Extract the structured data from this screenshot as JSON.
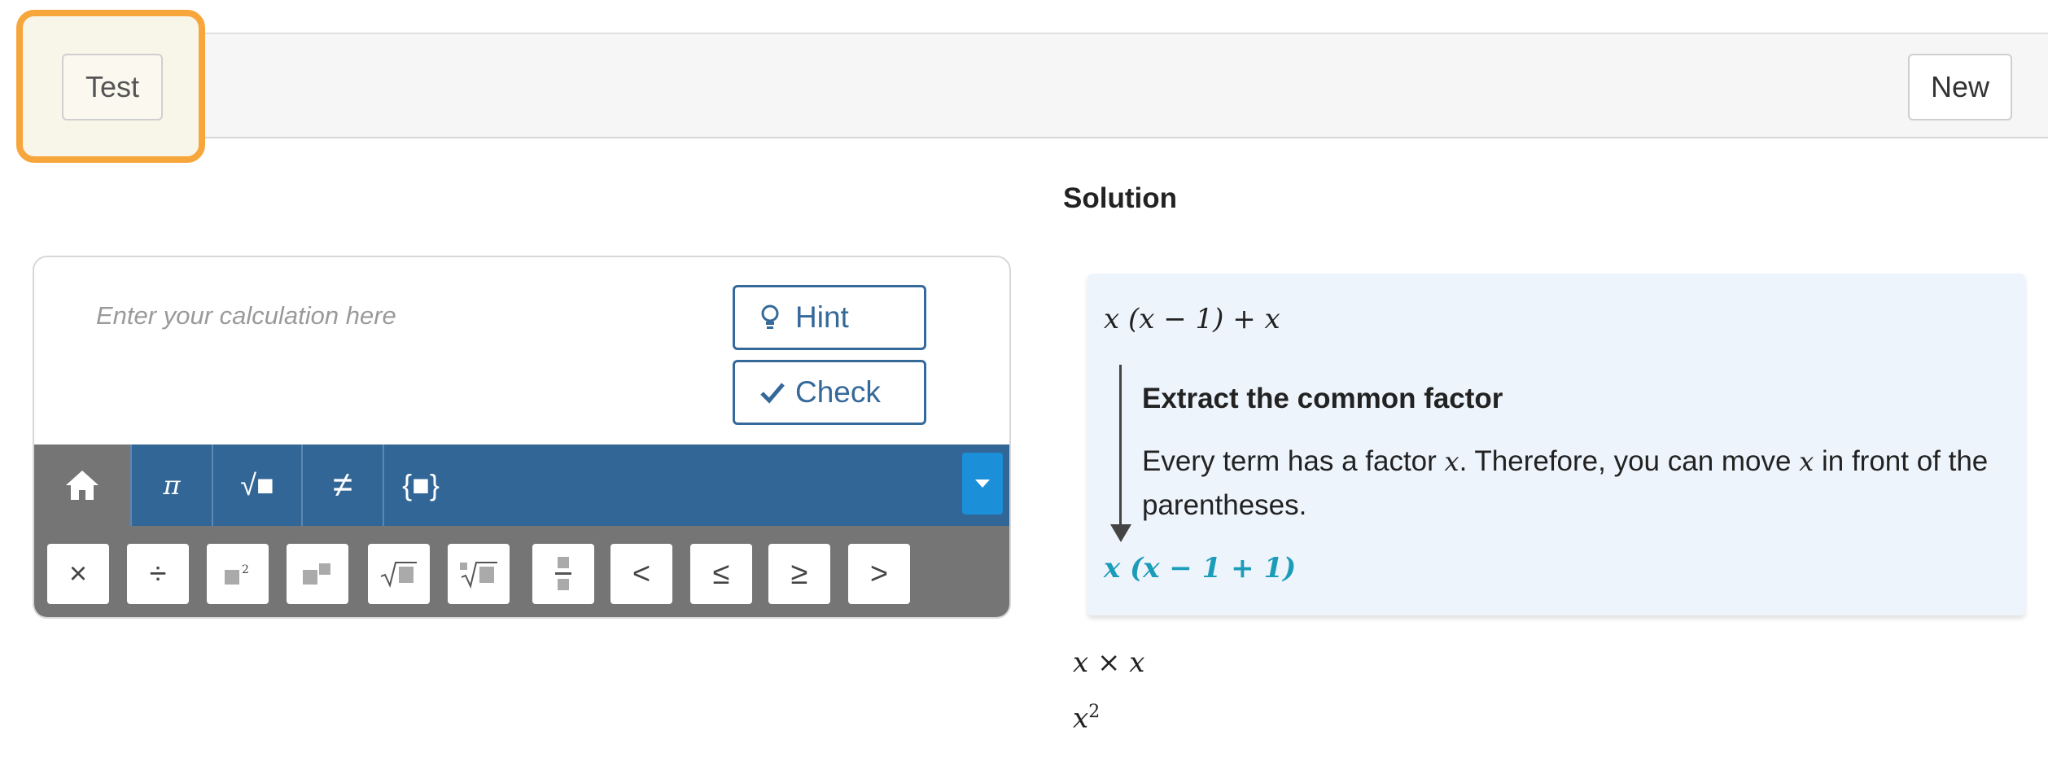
{
  "toolbar": {
    "test_label": "Test",
    "new_label": "New"
  },
  "solution": {
    "heading": "Solution",
    "expression_start": "x (x − 1) + x",
    "step": {
      "title": "Extract the common factor",
      "text_part1": "Every term has a factor ",
      "var1": "x",
      "text_part2": ". Therefore, you can move ",
      "var2": "x",
      "text_part3": " in front of the parentheses.",
      "result": "x (x − 1 + 1)"
    },
    "line2": "x × x",
    "line3_base": "x",
    "line3_exp": "2"
  },
  "calculator": {
    "placeholder": "Enter your calculation here",
    "hint_label": "Hint",
    "check_label": "Check",
    "tabs": {
      "pi": "π",
      "sqrt": "√■",
      "neq": "≠",
      "set": "{■}"
    },
    "keys": {
      "times": "×",
      "divide": "÷",
      "lt": "<",
      "le": "≤",
      "ge": "≥",
      "gt": ">"
    }
  },
  "colors": {
    "accent": "#326697",
    "highlight": "#f7a63b",
    "result": "#1b9cb8"
  }
}
